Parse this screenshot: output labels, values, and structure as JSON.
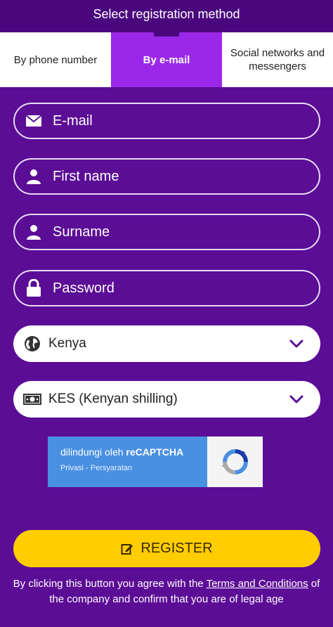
{
  "header": {
    "title": "Select registration method"
  },
  "tabs": [
    {
      "label": "By phone number"
    },
    {
      "label": "By e-mail"
    },
    {
      "label": "Social networks and messengers"
    }
  ],
  "form": {
    "email_placeholder": "E-mail",
    "first_name_placeholder": "First name",
    "surname_placeholder": "Surname",
    "password_placeholder": "Password",
    "country_value": "Kenya",
    "currency_value": "KES (Kenyan shilling)"
  },
  "recaptcha": {
    "line1_prefix": "dilindungi oleh ",
    "line1_brand": "reCAPTCHA",
    "privacy": "Privasi",
    "separator": " - ",
    "terms": "Persyaratan"
  },
  "register": {
    "label": "REGISTER"
  },
  "terms": {
    "before": "By clicking this button you agree with the ",
    "link": "Terms and Conditions",
    "after": " of the company and confirm that you are of legal age"
  },
  "colors": {
    "background": "#5b0d96",
    "header": "#4a077d",
    "active_tab": "#9b28e8",
    "register_button": "#ffcd00",
    "recaptcha": "#4a90e2"
  }
}
